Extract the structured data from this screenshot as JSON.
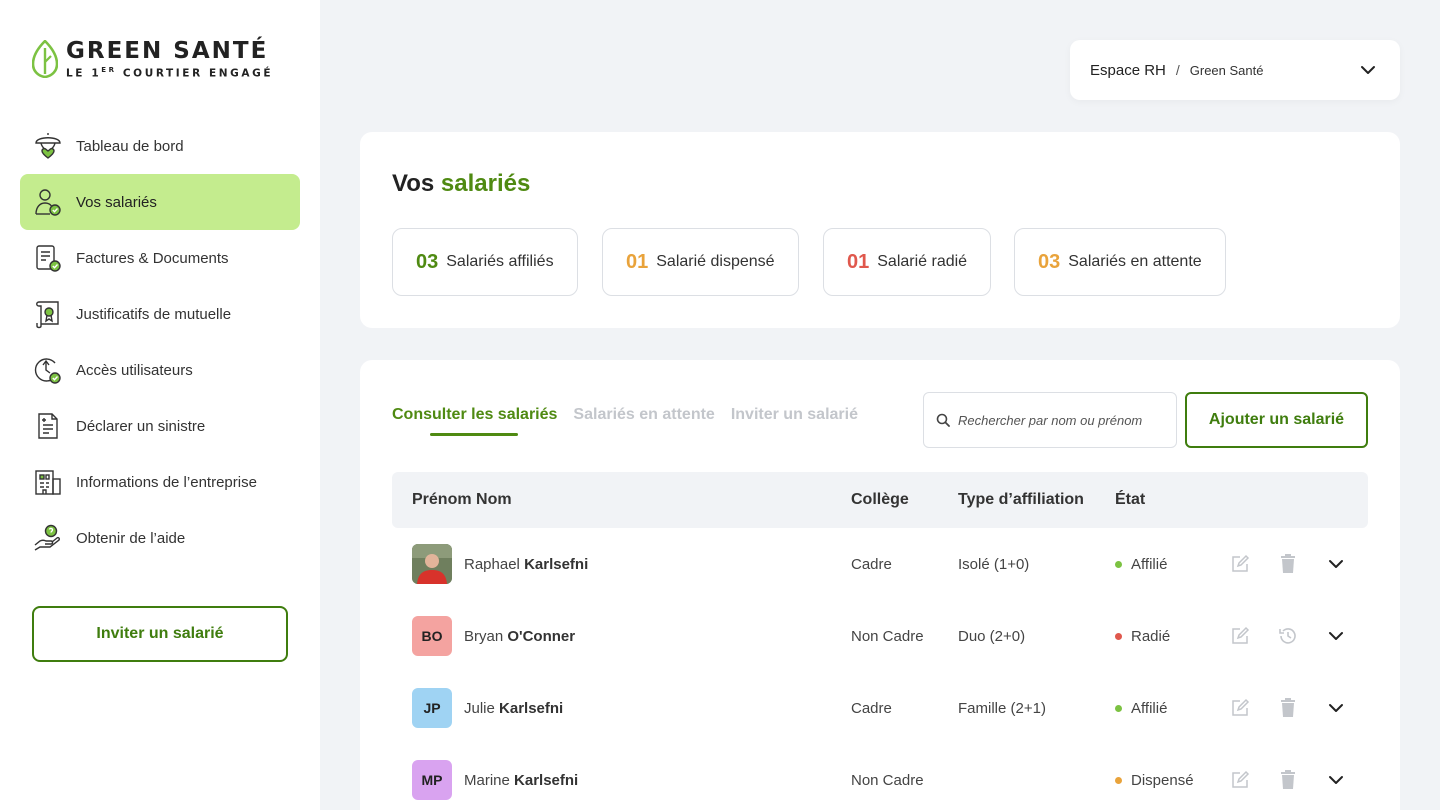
{
  "brand": {
    "name": "GREEN SANTÉ",
    "tagline_pre": "LE 1",
    "tagline_sup": "ER",
    "tagline_post": " COURTIER ENGAGÉ"
  },
  "sidebar": {
    "items": [
      {
        "label": "Tableau de bord",
        "icon": "dashboard-umbrella-icon",
        "active": false
      },
      {
        "label": "Vos salariés",
        "icon": "employee-icon",
        "active": true
      },
      {
        "label": "Factures & Documents",
        "icon": "invoice-icon",
        "active": false
      },
      {
        "label": "Justificatifs de mutuelle",
        "icon": "certificate-icon",
        "active": false
      },
      {
        "label": "Accès utilisateurs",
        "icon": "user-access-icon",
        "active": false
      },
      {
        "label": "Déclarer un sinistre",
        "icon": "claim-icon",
        "active": false
      },
      {
        "label": "Informations de l’entreprise",
        "icon": "building-icon",
        "active": false
      },
      {
        "label": "Obtenir de l’aide",
        "icon": "help-hand-icon",
        "active": false
      }
    ],
    "invite_label": "Inviter un salarié"
  },
  "space": {
    "main": "Espace RH",
    "separator": "/",
    "company": "Green Santé"
  },
  "summary": {
    "title_pre": "Vos ",
    "title_accent": "salariés",
    "stats": [
      {
        "num": "03",
        "label": "Salariés affiliés",
        "color": "#4f8a12"
      },
      {
        "num": "01",
        "label": "Salarié dispensé",
        "color": "#e9a33b"
      },
      {
        "num": "01",
        "label": "Salarié radié",
        "color": "#e0584d"
      },
      {
        "num": "03",
        "label": "Salariés en attente",
        "color": "#e9a33b"
      }
    ]
  },
  "tabs": [
    {
      "label": "Consulter les salariés",
      "active": true
    },
    {
      "label": "Salariés en attente",
      "active": false
    },
    {
      "label": "Inviter un salarié",
      "active": false
    }
  ],
  "search": {
    "placeholder": "Rechercher par nom ou prénom"
  },
  "add_button": "Ajouter un salarié",
  "table": {
    "headers": {
      "name": "Prénom Nom",
      "college": "Collège",
      "type": "Type d’affiliation",
      "state": "État"
    },
    "rows": [
      {
        "initials": "",
        "photo": true,
        "avatar_color": "#a8b0a0",
        "first": "Raphael",
        "last": "Karlsefni",
        "college": "Cadre",
        "type": "Isolé (1+0)",
        "state": "Affilié",
        "state_color": "#7cc242",
        "second_action": "trash-icon"
      },
      {
        "initials": "BO",
        "photo": false,
        "avatar_color": "#f4a3a0",
        "first": "Bryan",
        "last": "O'Conner",
        "college": "Non Cadre",
        "type": "Duo (2+0)",
        "state": "Radié",
        "state_color": "#e0584d",
        "second_action": "restore-icon"
      },
      {
        "initials": "JP",
        "photo": false,
        "avatar_color": "#9fd3f3",
        "first": "Julie",
        "last": "Karlsefni",
        "college": "Cadre",
        "type": "Famille (2+1)",
        "state": "Affilié",
        "state_color": "#7cc242",
        "second_action": "trash-icon"
      },
      {
        "initials": "MP",
        "photo": false,
        "avatar_color": "#d9a3f0",
        "first": "Marine",
        "last": "Karlsefni",
        "college": "Non Cadre",
        "type": "",
        "state": "Dispensé",
        "state_color": "#e9a33b",
        "second_action": "trash-icon"
      }
    ]
  }
}
